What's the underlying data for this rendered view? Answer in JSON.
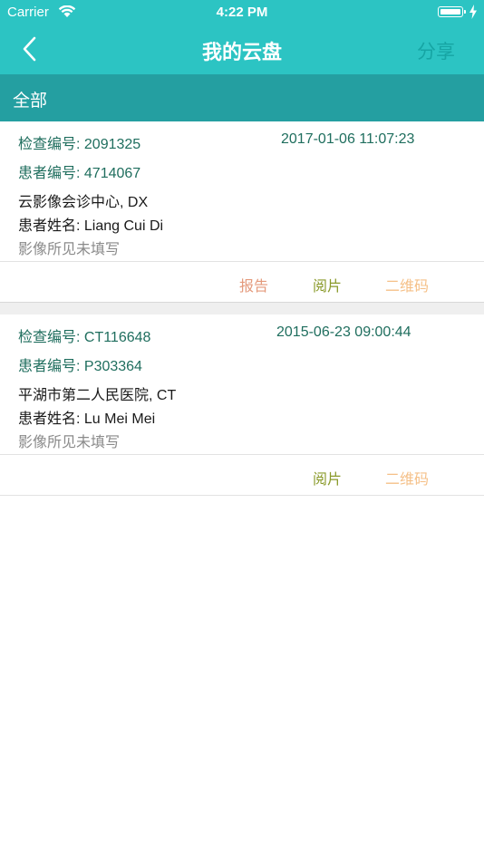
{
  "status_bar": {
    "carrier": "Carrier",
    "time": "4:22 PM"
  },
  "nav": {
    "title": "我的云盘",
    "share_label": "分享"
  },
  "category": {
    "label": "全部"
  },
  "records": [
    {
      "exam_no": "检查编号: 2091325",
      "datetime": "2017-01-06 11:07:23",
      "patient_no": "患者编号: 4714067",
      "hospital": "云影像会诊中心, DX",
      "patient_name": "患者姓名: Liang Cui Di",
      "findings": "影像所见未填写",
      "actions": {
        "report": "报告",
        "view": "阅片",
        "qr": "二维码"
      }
    },
    {
      "exam_no": "检查编号: CT116648",
      "datetime": "2015-06-23 09:00:44",
      "patient_no": "患者编号: P303364",
      "hospital": "平湖市第二人民医院, CT",
      "patient_name": "患者姓名: Lu Mei Mei",
      "findings": "影像所见未填写",
      "actions": {
        "view": "阅片",
        "qr": "二维码"
      }
    }
  ],
  "colors": {
    "nav_bg": "#2cc4c3",
    "category_bg": "#249fa1",
    "teal_text": "#1f6e5e",
    "report_action": "#e49a7c",
    "view_action": "#8a9a2a",
    "qr_action": "#f5c088"
  }
}
